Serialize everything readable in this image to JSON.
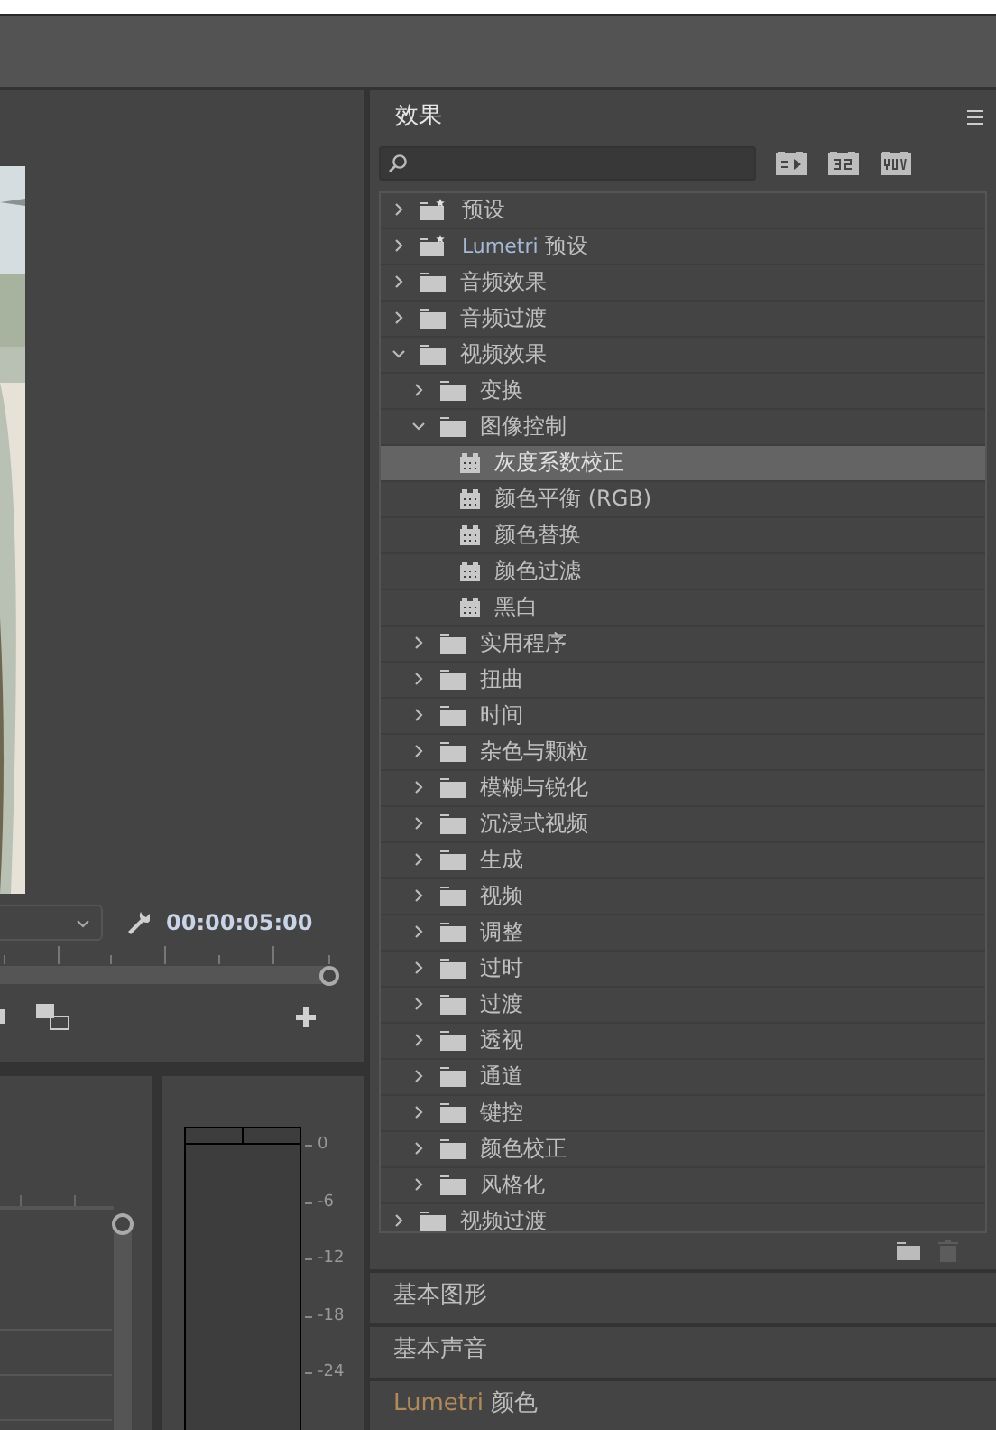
{
  "program_monitor": {
    "timecode": "00:00:05:00",
    "playhead": {
      "level": 1
    }
  },
  "meter": {
    "scale": [
      "0",
      "-6",
      "-12",
      "-18",
      "-24"
    ]
  },
  "effects_panel": {
    "title": "效果",
    "tree": [
      {
        "kind": "preset",
        "label": "预设",
        "expanded": false,
        "selected": false
      },
      {
        "kind": "preset",
        "label": "**Lumetri** 预设",
        "expanded": false,
        "selected": false
      },
      {
        "kind": "folder",
        "label": "音频效果",
        "expanded": false,
        "selected": false
      },
      {
        "kind": "folder",
        "label": "音频过渡",
        "expanded": false,
        "selected": false
      },
      {
        "kind": "folder",
        "label": "视频效果",
        "expanded": true,
        "selected": false,
        "children": [
          {
            "kind": "folder",
            "label": "变换",
            "expanded": false,
            "selected": false
          },
          {
            "kind": "folder",
            "label": "图像控制",
            "expanded": true,
            "selected": false,
            "children": [
              {
                "kind": "effect",
                "label": "灰度系数校正",
                "selected": true
              },
              {
                "kind": "effect",
                "label": "颜色平衡 (RGB)",
                "selected": false
              },
              {
                "kind": "effect",
                "label": "颜色替换",
                "selected": false
              },
              {
                "kind": "effect",
                "label": "颜色过滤",
                "selected": false
              },
              {
                "kind": "effect",
                "label": "黑白",
                "selected": false
              }
            ]
          },
          {
            "kind": "folder",
            "label": "实用程序",
            "expanded": false,
            "selected": false
          },
          {
            "kind": "folder",
            "label": "扭曲",
            "expanded": false,
            "selected": false
          },
          {
            "kind": "folder",
            "label": "时间",
            "expanded": false,
            "selected": false
          },
          {
            "kind": "folder",
            "label": "杂色与颗粒",
            "expanded": false,
            "selected": false
          },
          {
            "kind": "folder",
            "label": "模糊与锐化",
            "expanded": false,
            "selected": false
          },
          {
            "kind": "folder",
            "label": "沉浸式视频",
            "expanded": false,
            "selected": false
          },
          {
            "kind": "folder",
            "label": "生成",
            "expanded": false,
            "selected": false
          },
          {
            "kind": "folder",
            "label": "视频",
            "expanded": false,
            "selected": false
          },
          {
            "kind": "folder",
            "label": "调整",
            "expanded": false,
            "selected": false
          },
          {
            "kind": "folder",
            "label": "过时",
            "expanded": false,
            "selected": false
          },
          {
            "kind": "folder",
            "label": "过渡",
            "expanded": false,
            "selected": false
          },
          {
            "kind": "folder",
            "label": "透视",
            "expanded": false,
            "selected": false
          },
          {
            "kind": "folder",
            "label": "通道",
            "expanded": false,
            "selected": false
          },
          {
            "kind": "folder",
            "label": "键控",
            "expanded": false,
            "selected": false
          },
          {
            "kind": "folder",
            "label": "颜色校正",
            "expanded": false,
            "selected": false
          },
          {
            "kind": "folder",
            "label": "风格化",
            "expanded": false,
            "selected": false
          }
        ]
      },
      {
        "kind": "folder",
        "label": "视频过渡",
        "expanded": false,
        "selected": false
      }
    ]
  },
  "sections": [
    "基本图形",
    "基本声音",
    "**Lumetri** 颜色"
  ]
}
